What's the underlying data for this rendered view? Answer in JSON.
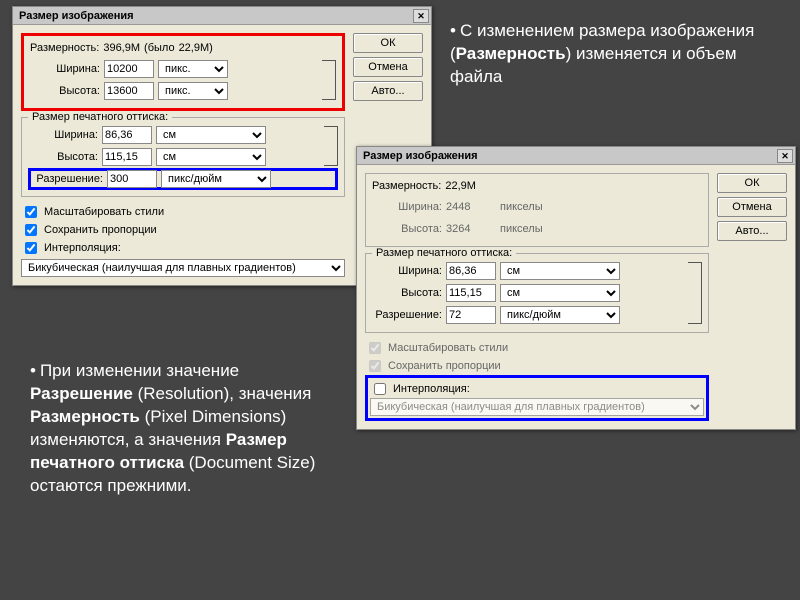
{
  "dialog1": {
    "title": "Размер изображения",
    "close": "✕",
    "pixelDimensions": {
      "title_prefix": "Размерность:",
      "size_current": "396,9M",
      "size_was_prefix": "(было",
      "size_was": "22,9M)",
      "width_label": "Ширина:",
      "width_value": "10200",
      "width_unit": "пикс.",
      "height_label": "Высота:",
      "height_value": "13600",
      "height_unit": "пикс."
    },
    "documentSize": {
      "title": "Размер печатного оттиска:",
      "width_label": "Ширина:",
      "width_value": "86,36",
      "width_unit": "см",
      "height_label": "Высота:",
      "height_value": "115,15",
      "height_unit": "см",
      "resolution_label": "Разрешение:",
      "resolution_value": "300",
      "resolution_unit": "пикс/дюйм"
    },
    "checks": {
      "scale_styles": "Масштабировать стили",
      "constrain": "Сохранить пропорции",
      "resample": "Интерполяция:"
    },
    "resample_method": "Бикубическая (наилучшая для плавных градиентов)",
    "buttons": {
      "ok": "ОК",
      "cancel": "Отмена",
      "auto": "Авто..."
    }
  },
  "dialog2": {
    "title": "Размер изображения",
    "close": "✕",
    "pixelDimensions": {
      "title_prefix": "Размерность:",
      "size_current": "22,9M",
      "width_label": "Ширина:",
      "width_value": "2448",
      "width_unit": "пикселы",
      "height_label": "Высота:",
      "height_value": "3264",
      "height_unit": "пикселы"
    },
    "documentSize": {
      "title": "Размер печатного оттиска:",
      "width_label": "Ширина:",
      "width_value": "86,36",
      "width_unit": "см",
      "height_label": "Высота:",
      "height_value": "115,15",
      "height_unit": "см",
      "resolution_label": "Разрешение:",
      "resolution_value": "72",
      "resolution_unit": "пикс/дюйм"
    },
    "checks": {
      "scale_styles": "Масштабировать стили",
      "constrain": "Сохранить пропорции",
      "resample": "Интерполяция:"
    },
    "resample_method": "Бикубическая (наилучшая для плавных градиентов)",
    "buttons": {
      "ok": "ОК",
      "cancel": "Отмена",
      "auto": "Авто..."
    }
  },
  "captions": {
    "topRight": {
      "pre": "С изменением размера изображения (",
      "bold1": "Размерность",
      "post1": ") изменяется и объем файла"
    },
    "bottomLeft": {
      "pre": "При изменении значение ",
      "bold1": "Разрешение",
      "mid1": " (Resolution), значения ",
      "bold2": "Размерность",
      "mid2": " (Pixel Dimensions) изменяются, а значения ",
      "bold3": "Размер печатного оттиска",
      "mid3": " (Document Size) остаются прежними."
    }
  }
}
